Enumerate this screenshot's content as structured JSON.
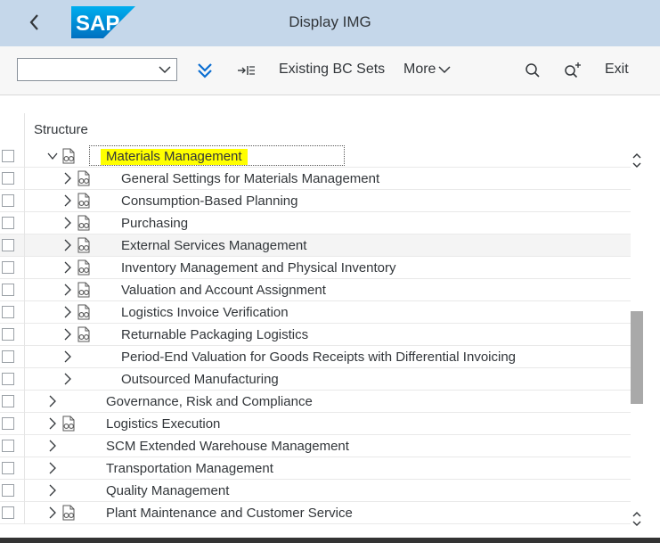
{
  "shell": {
    "title": "Display IMG",
    "logo_text": "SAP",
    "back_icon": "chevron-left-icon"
  },
  "toolbar": {
    "dropdown_value": "",
    "expand_all_icon": "double-chevron-down-icon",
    "move_icon": "arrow-right-list-icon",
    "existing_bc_sets": "Existing BC Sets",
    "more": "More",
    "search_icon": "search-icon",
    "search_plus_icon": "search-plus-icon",
    "exit": "Exit"
  },
  "table": {
    "header": "Structure",
    "rows": [
      {
        "label": "Materials Management",
        "level": 1,
        "expanded": true,
        "has_icon": true,
        "selected": true
      },
      {
        "label": "General Settings for Materials Management",
        "level": 2,
        "expanded": false,
        "has_icon": true
      },
      {
        "label": "Consumption-Based Planning",
        "level": 2,
        "expanded": false,
        "has_icon": true
      },
      {
        "label": "Purchasing",
        "level": 2,
        "expanded": false,
        "has_icon": true
      },
      {
        "label": "External Services Management",
        "level": 2,
        "expanded": false,
        "has_icon": true
      },
      {
        "label": "Inventory Management and Physical Inventory",
        "level": 2,
        "expanded": false,
        "has_icon": true
      },
      {
        "label": "Valuation and Account Assignment",
        "level": 2,
        "expanded": false,
        "has_icon": true
      },
      {
        "label": "Logistics Invoice Verification",
        "level": 2,
        "expanded": false,
        "has_icon": true
      },
      {
        "label": "Returnable Packaging Logistics",
        "level": 2,
        "expanded": false,
        "has_icon": true
      },
      {
        "label": "Period-End Valuation for Goods Receipts with Differential Invoicing",
        "level": 2,
        "expanded": false,
        "has_icon": false
      },
      {
        "label": "Outsourced Manufacturing",
        "level": 2,
        "expanded": false,
        "has_icon": false
      },
      {
        "label": "Governance, Risk and Compliance",
        "level": 1,
        "expanded": false,
        "has_icon": false
      },
      {
        "label": "Logistics Execution",
        "level": 1,
        "expanded": false,
        "has_icon": true
      },
      {
        "label": "SCM Extended Warehouse Management",
        "level": 1,
        "expanded": false,
        "has_icon": false
      },
      {
        "label": "Transportation Management",
        "level": 1,
        "expanded": false,
        "has_icon": false
      },
      {
        "label": "Quality Management",
        "level": 1,
        "expanded": false,
        "has_icon": false
      },
      {
        "label": "Plant Maintenance and Customer Service",
        "level": 1,
        "expanded": false,
        "has_icon": true
      }
    ]
  },
  "colors": {
    "shell_bg": "#c5d7ea",
    "toolbar_bg": "#f7f7f7",
    "highlight": "#ffff00",
    "hover_row": "#f4f4f4",
    "scroll_thumb": "#a9a9a9"
  }
}
